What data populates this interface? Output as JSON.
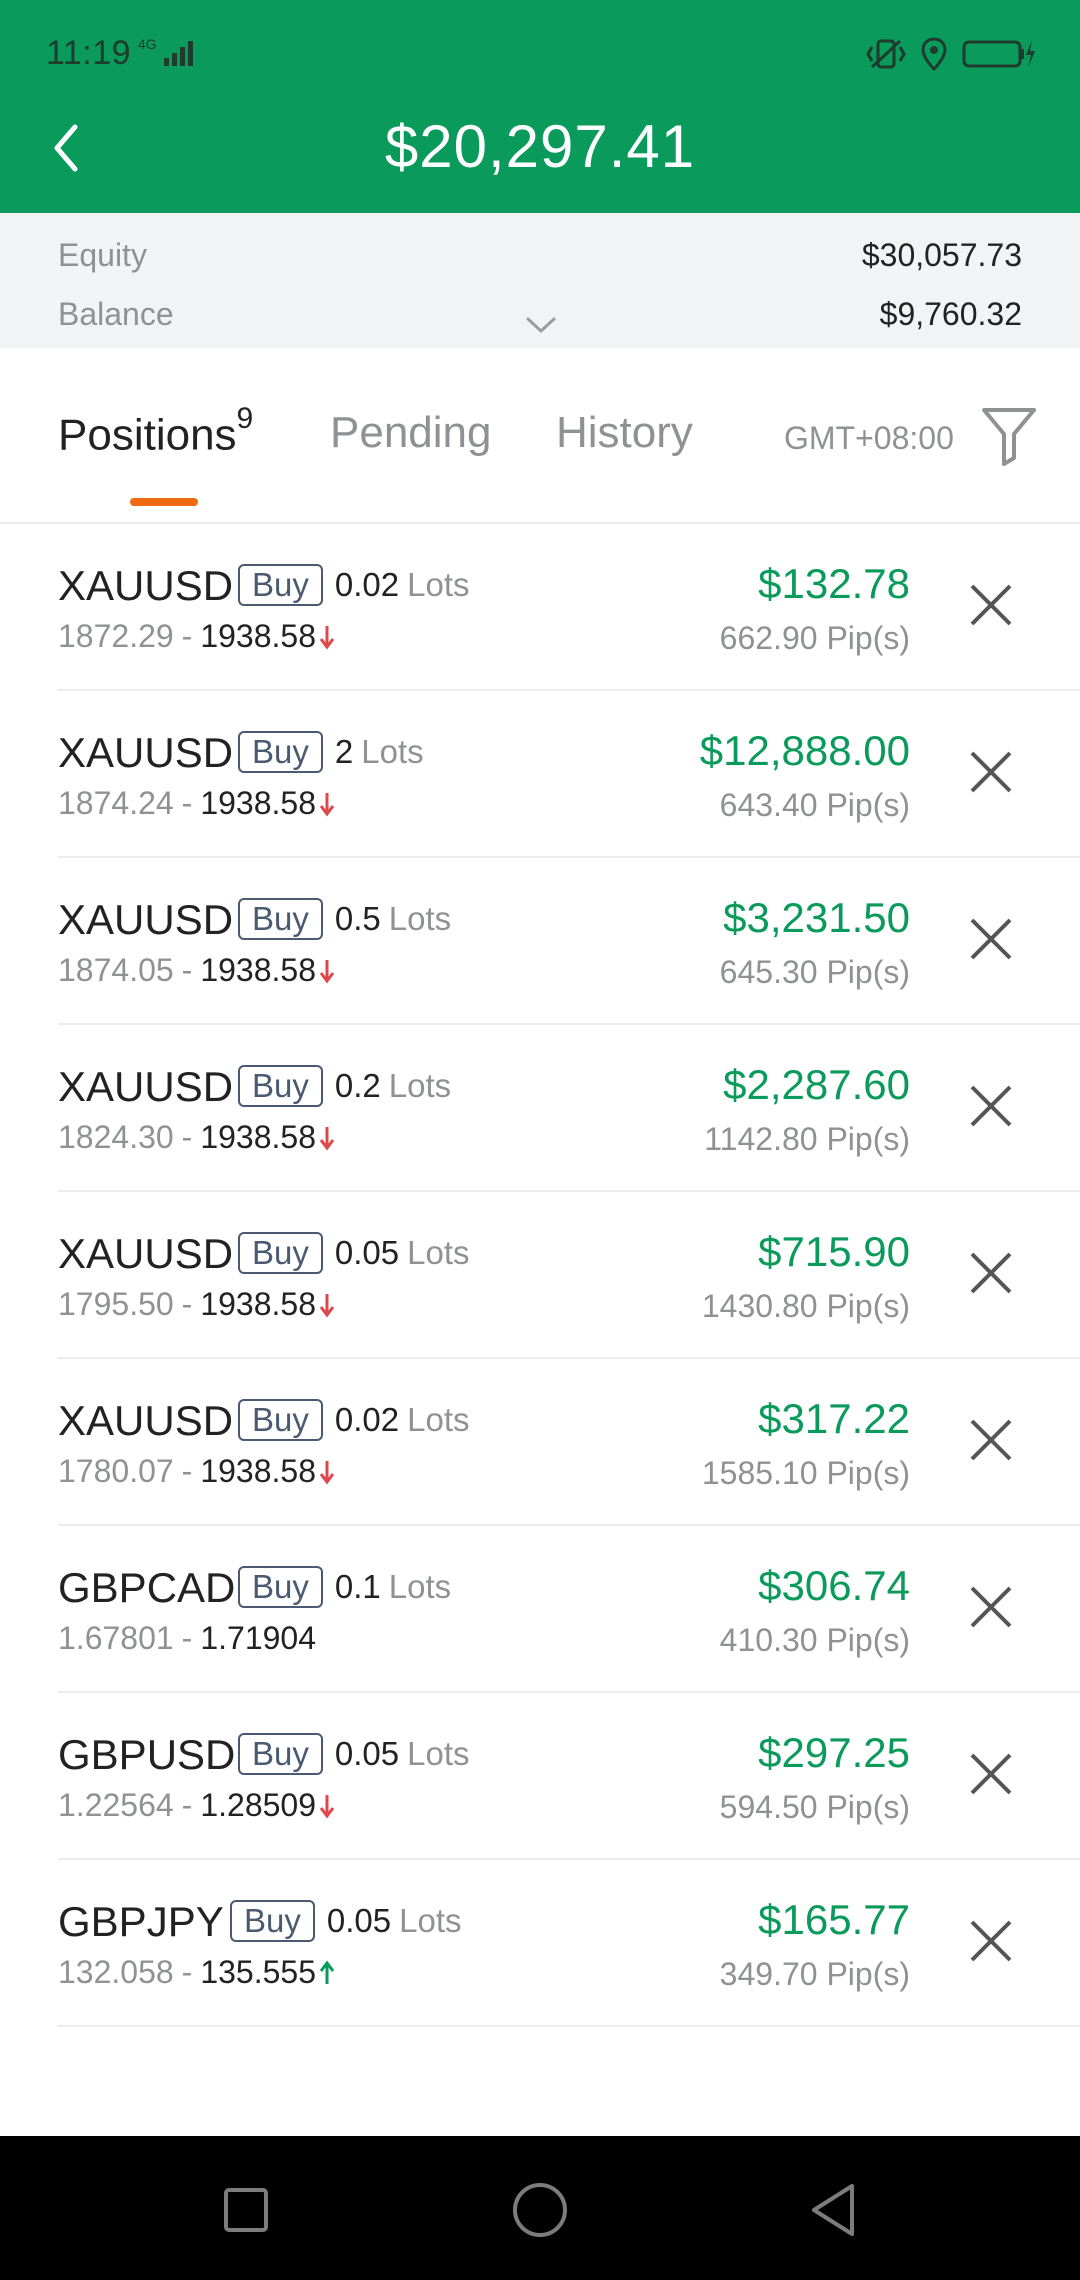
{
  "status": {
    "time": "11:19",
    "network": "4G"
  },
  "header": {
    "title": "$20,297.41"
  },
  "summary": {
    "equity_label": "Equity",
    "equity_value": "$30,057.73",
    "balance_label": "Balance",
    "balance_value": "$9,760.32"
  },
  "tabs": {
    "positions": "Positions",
    "positions_count": "9",
    "pending": "Pending",
    "history": "History",
    "timezone": "GMT+08:00"
  },
  "colors": {
    "brand": "#0a9a5c",
    "accent": "#f06a12",
    "down": "#e0474c",
    "up": "#0a9a5c"
  },
  "positions": [
    {
      "symbol": "XAUUSD",
      "side": "Buy",
      "lots": "0.02",
      "lots_label": "Lots",
      "open": "1872.29",
      "sep": "-",
      "current": "1938.58",
      "trend": "down",
      "pl": "$132.78",
      "pips": "662.90 Pip(s)"
    },
    {
      "symbol": "XAUUSD",
      "side": "Buy",
      "lots": "2",
      "lots_label": "Lots",
      "open": "1874.24",
      "sep": "-",
      "current": "1938.58",
      "trend": "down",
      "pl": "$12,888.00",
      "pips": "643.40 Pip(s)"
    },
    {
      "symbol": "XAUUSD",
      "side": "Buy",
      "lots": "0.5",
      "lots_label": "Lots",
      "open": "1874.05",
      "sep": "-",
      "current": "1938.58",
      "trend": "down",
      "pl": "$3,231.50",
      "pips": "645.30 Pip(s)"
    },
    {
      "symbol": "XAUUSD",
      "side": "Buy",
      "lots": "0.2",
      "lots_label": "Lots",
      "open": "1824.30",
      "sep": "-",
      "current": "1938.58",
      "trend": "down",
      "pl": "$2,287.60",
      "pips": "1142.80 Pip(s)"
    },
    {
      "symbol": "XAUUSD",
      "side": "Buy",
      "lots": "0.05",
      "lots_label": "Lots",
      "open": "1795.50",
      "sep": "-",
      "current": "1938.58",
      "trend": "down",
      "pl": "$715.90",
      "pips": "1430.80 Pip(s)"
    },
    {
      "symbol": "XAUUSD",
      "side": "Buy",
      "lots": "0.02",
      "lots_label": "Lots",
      "open": "1780.07",
      "sep": "-",
      "current": "1938.58",
      "trend": "down",
      "pl": "$317.22",
      "pips": "1585.10 Pip(s)"
    },
    {
      "symbol": "GBPCAD",
      "side": "Buy",
      "lots": "0.1",
      "lots_label": "Lots",
      "open": "1.67801",
      "sep": "-",
      "current": "1.71904",
      "trend": "none",
      "pl": "$306.74",
      "pips": "410.30 Pip(s)"
    },
    {
      "symbol": "GBPUSD",
      "side": "Buy",
      "lots": "0.05",
      "lots_label": "Lots",
      "open": "1.22564",
      "sep": "-",
      "current": "1.28509",
      "trend": "down",
      "pl": "$297.25",
      "pips": "594.50 Pip(s)"
    },
    {
      "symbol": "GBPJPY",
      "side": "Buy",
      "lots": "0.05",
      "lots_label": "Lots",
      "open": "132.058",
      "sep": "-",
      "current": "135.555",
      "trend": "up",
      "pl": "$165.77",
      "pips": "349.70 Pip(s)"
    }
  ]
}
